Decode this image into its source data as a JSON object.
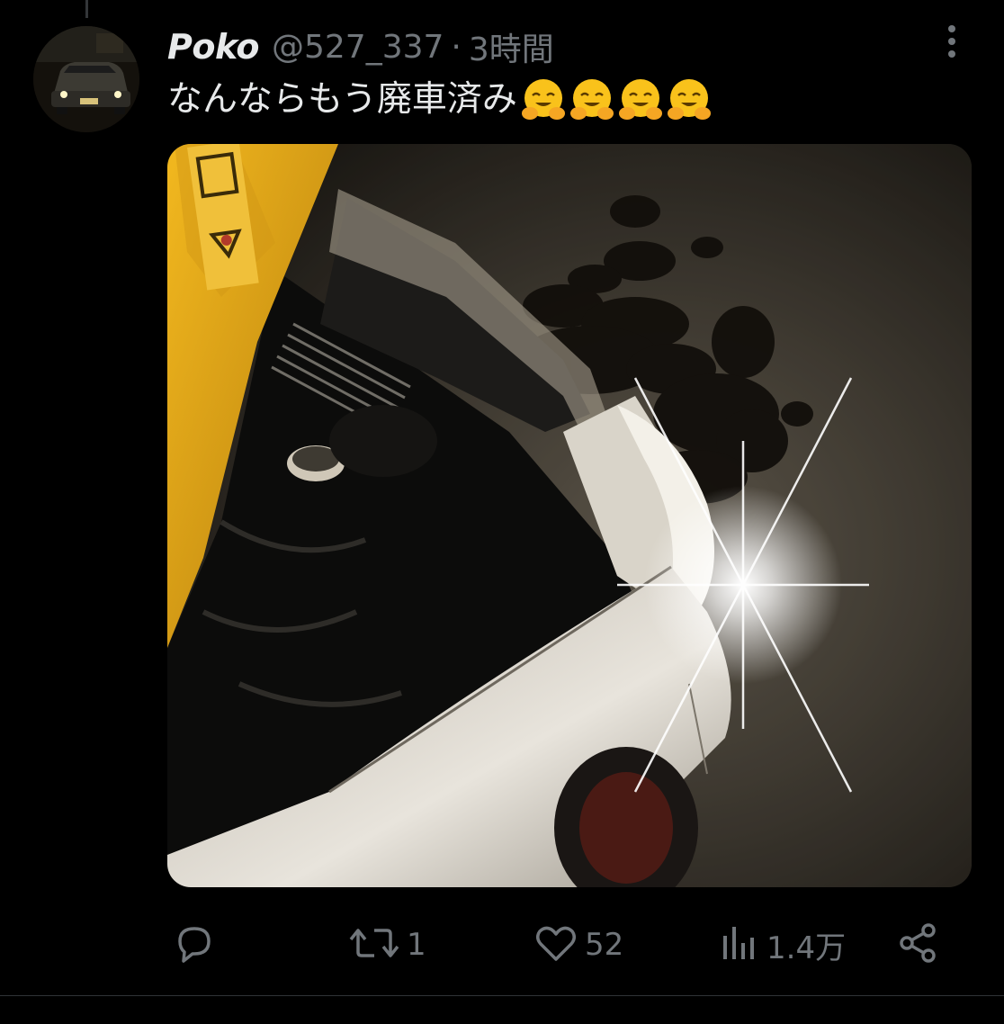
{
  "tweet": {
    "display_name": "Poko",
    "handle": "@527_337",
    "separator": "·",
    "time": "3時間",
    "text": "なんならもう廃車済み",
    "emojis": [
      "hugging-face",
      "hugging-face",
      "hugging-face",
      "hugging-face"
    ]
  },
  "actions": {
    "reply": {
      "icon": "reply-icon",
      "count": ""
    },
    "retweet": {
      "icon": "retweet-icon",
      "count": "1"
    },
    "like": {
      "icon": "heart-icon",
      "count": "52"
    },
    "views": {
      "icon": "views-icon",
      "count": "1.4万"
    },
    "share": {
      "icon": "share-icon"
    }
  },
  "colors": {
    "background": "#000000",
    "primary_text": "#e7e9ea",
    "secondary_text": "#71767b",
    "divider": "#2f3336",
    "hood_yellow": "#e2a417"
  }
}
